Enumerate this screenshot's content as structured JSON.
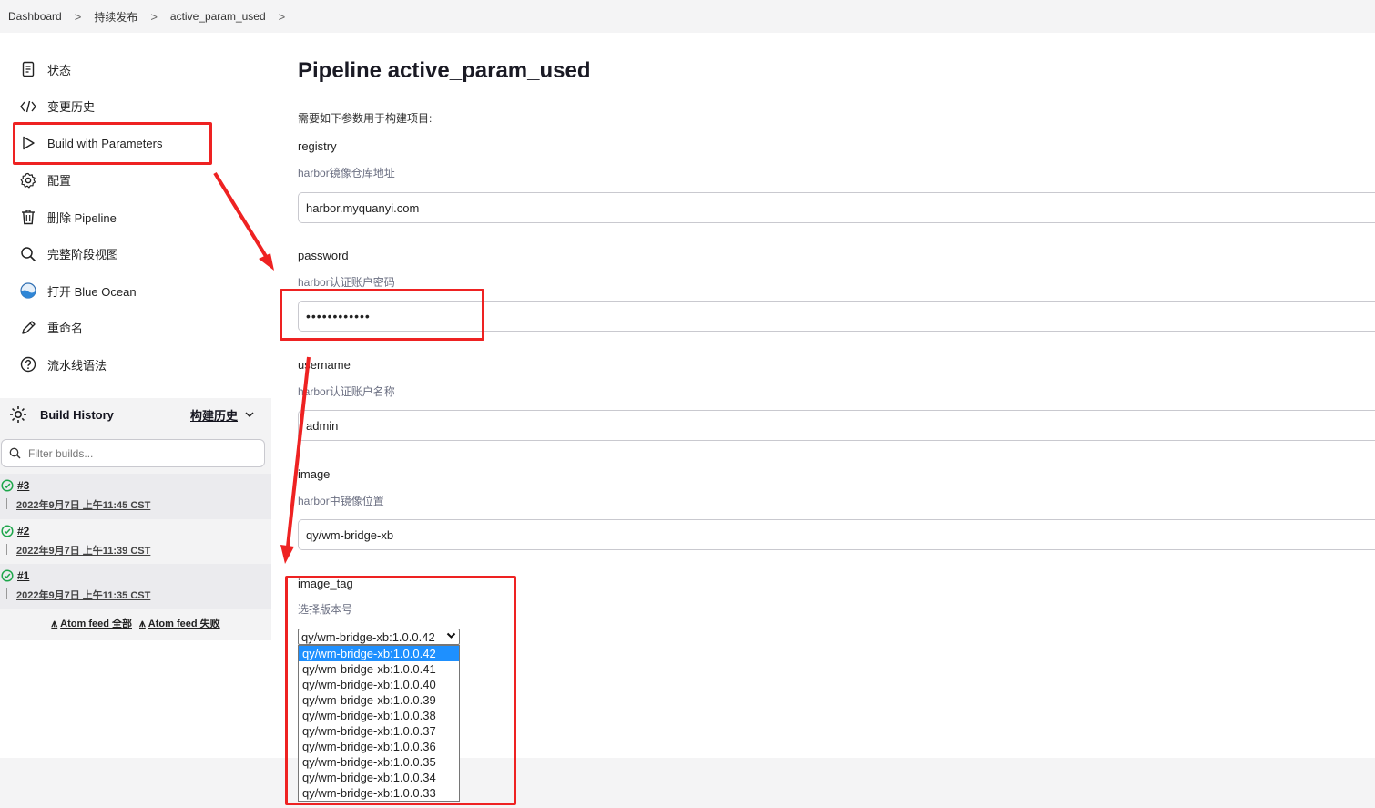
{
  "breadcrumb": {
    "items": [
      "Dashboard",
      "持续发布",
      "active_param_used"
    ],
    "separator": ">"
  },
  "sidebar": {
    "items": [
      {
        "label": "状态",
        "icon": "document-icon"
      },
      {
        "label": "变更历史",
        "icon": "code-icon"
      },
      {
        "label": "Build with Parameters",
        "icon": "play-icon"
      },
      {
        "label": "配置",
        "icon": "gear-icon"
      },
      {
        "label": "删除 Pipeline",
        "icon": "trash-icon"
      },
      {
        "label": "完整阶段视图",
        "icon": "search-icon"
      },
      {
        "label": "打开 Blue Ocean",
        "icon": "blue-ocean-icon"
      },
      {
        "label": "重命名",
        "icon": "pencil-icon"
      },
      {
        "label": "流水线语法",
        "icon": "help-icon"
      }
    ]
  },
  "build_history": {
    "title": "Build History",
    "trend_label": "构建历史",
    "filter_placeholder": "Filter builds...",
    "builds": [
      {
        "number": "#3",
        "time": "2022年9月7日 上午11:45 CST"
      },
      {
        "number": "#2",
        "time": "2022年9月7日 上午11:39 CST"
      },
      {
        "number": "#1",
        "time": "2022年9月7日 上午11:35 CST"
      }
    ],
    "feeds": [
      "Atom feed 全部",
      "Atom feed 失败"
    ]
  },
  "main": {
    "title": "Pipeline active_param_used",
    "intro": "需要如下参数用于构建项目:",
    "params": [
      {
        "name": "registry",
        "description": "harbor镜像仓库地址",
        "value": "harbor.myquanyi.com"
      },
      {
        "name": "password",
        "description": "harbor认证账户密码",
        "value": "••••••••••••"
      },
      {
        "name": "username",
        "description": "harbor认证账户名称",
        "value": "admin"
      },
      {
        "name": "image",
        "description": "harbor中镜像位置",
        "value": "qy/wm-bridge-xb"
      }
    ],
    "image_tag": {
      "name": "image_tag",
      "description": "选择版本号",
      "selected": "qy/wm-bridge-xb:1.0.0.42",
      "options": [
        "qy/wm-bridge-xb:1.0.0.42",
        "qy/wm-bridge-xb:1.0.0.41",
        "qy/wm-bridge-xb:1.0.0.40",
        "qy/wm-bridge-xb:1.0.0.39",
        "qy/wm-bridge-xb:1.0.0.38",
        "qy/wm-bridge-xb:1.0.0.37",
        "qy/wm-bridge-xb:1.0.0.36",
        "qy/wm-bridge-xb:1.0.0.35",
        "qy/wm-bridge-xb:1.0.0.34",
        "qy/wm-bridge-xb:1.0.0.33"
      ]
    }
  },
  "colors": {
    "annotation": "#ee2222",
    "selected_option": "#1e90ff",
    "success": "#1ea64b"
  }
}
